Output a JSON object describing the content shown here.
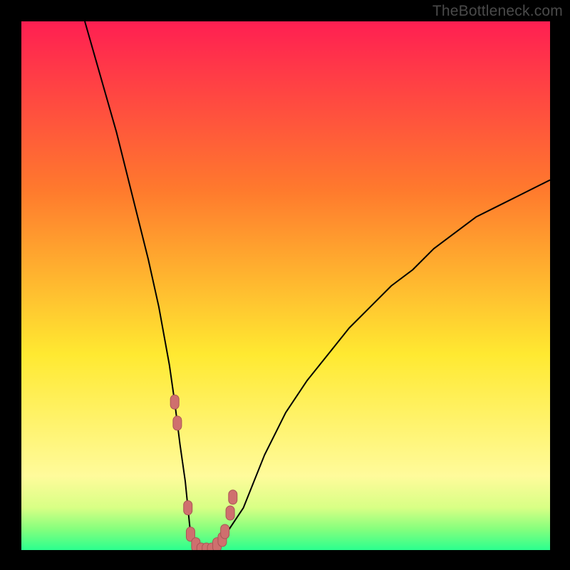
{
  "watermark": "TheBottleneck.com",
  "colors": {
    "frame": "#000000",
    "curve": "#000000",
    "marker_fill": "#cf6f6e",
    "marker_stroke": "#a95555",
    "grad_top": "#ff1f52",
    "grad_mid1": "#ff7a2d",
    "grad_mid2": "#ffe931",
    "grad_band1": "#fffb9b",
    "grad_band2": "#d8ff85",
    "grad_band3": "#86ff7d",
    "grad_bottom": "#2bff8e"
  },
  "chart_data": {
    "type": "line",
    "title": "",
    "xlabel": "",
    "ylabel": "",
    "xlim": [
      0,
      100
    ],
    "ylim": [
      0,
      100
    ],
    "notes": "Bottleneck-style V-curve over a rainbow severity gradient. Axes and ticks are hidden. Values below are estimated from pixel positions; y corresponds to bottleneck severity (0 = ideal/green bottom, 100 = worst/red top).",
    "series": [
      {
        "name": "curve",
        "x": [
          12,
          14,
          16,
          18,
          20,
          22,
          24,
          26,
          28,
          29,
          30,
          31,
          31.5,
          32,
          33,
          34,
          35,
          36,
          37,
          38,
          40,
          42,
          44,
          46,
          48,
          50,
          54,
          58,
          62,
          66,
          70,
          74,
          78,
          82,
          86,
          90,
          94,
          98,
          100
        ],
        "y": [
          100,
          93,
          86,
          79,
          71,
          63,
          55,
          46,
          35,
          28,
          20,
          13,
          8,
          3,
          1,
          0,
          0,
          0,
          1,
          2,
          5,
          8,
          13,
          18,
          22,
          26,
          32,
          37,
          42,
          46,
          50,
          53,
          57,
          60,
          63,
          65,
          67,
          69,
          70
        ]
      }
    ],
    "markers": {
      "name": "highlighted-range",
      "style": "thick-rounded-salmon",
      "x": [
        29.0,
        29.5,
        31.5,
        32.0,
        33.0,
        34.0,
        35.0,
        36.0,
        37.0,
        38.0,
        38.5,
        39.5,
        40.0
      ],
      "y": [
        28.0,
        24.0,
        8.0,
        3.0,
        1.0,
        0.0,
        0.0,
        0.0,
        1.0,
        2.0,
        3.5,
        7.0,
        10.0
      ]
    }
  }
}
